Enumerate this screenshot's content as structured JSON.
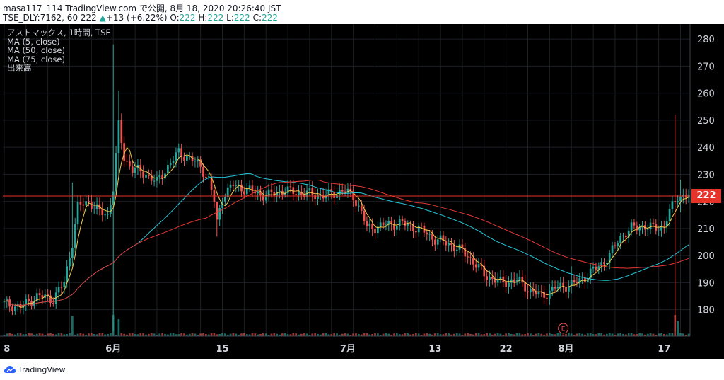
{
  "header": {
    "line1": "masa117_114 TradingView.com で公開, 8月 18, 2020 20:26:40 JST",
    "line2_symbol": "TSE_DLY:7162, 60 ",
    "line2_last": "222",
    "line2_arrow": "▲",
    "line2_change": "+13 (+6.22%)",
    "o_label": " O:",
    "o_value": "222",
    "h_label": " H:",
    "h_value": "222",
    "l_label": " L:",
    "l_value": "222",
    "c_label": " C:",
    "c_value": "222"
  },
  "legend": {
    "title": "アストマックス, 1時間, TSE",
    "ma5": "MA (5, close)",
    "ma50": "MA (50, close)",
    "ma75": "MA (75, close)",
    "volume": "出来高"
  },
  "footer": {
    "brand": "TradingView"
  },
  "price_tag": "222",
  "colors": {
    "up": "#26a69a",
    "down": "#ef5350",
    "ma5": "#f2c94c",
    "ma50": "#26c6da",
    "ma75": "#e53935",
    "price_line": "#e6342a",
    "axis_text": "#d1d4dc",
    "grid": "#1c1f26"
  },
  "chart_data": {
    "type": "candlestick",
    "interval": "1時間",
    "y_axis_ticks": [
      180,
      190,
      200,
      210,
      220,
      230,
      240,
      250,
      260,
      270,
      280
    ],
    "ylim": [
      171,
      285
    ],
    "x_tick_labels": [
      {
        "label": "8",
        "bar": 1
      },
      {
        "label": "6月",
        "bar": 40
      },
      {
        "label": "15",
        "bar": 80
      },
      {
        "label": "7月",
        "bar": 126
      },
      {
        "label": "13",
        "bar": 158
      },
      {
        "label": "22",
        "bar": 184
      },
      {
        "label": "8月",
        "bar": 206
      },
      {
        "label": "17",
        "bar": 242
      }
    ],
    "bar_count": 252,
    "close_anchors": [
      [
        0,
        182
      ],
      [
        6,
        181
      ],
      [
        12,
        185
      ],
      [
        18,
        184
      ],
      [
        22,
        190
      ],
      [
        25,
        205
      ],
      [
        27,
        218
      ],
      [
        31,
        220
      ],
      [
        35,
        216
      ],
      [
        38,
        215
      ],
      [
        40,
        225
      ],
      [
        42,
        248
      ],
      [
        44,
        236
      ],
      [
        47,
        232
      ],
      [
        52,
        230
      ],
      [
        56,
        227
      ],
      [
        60,
        233
      ],
      [
        64,
        238
      ],
      [
        68,
        236
      ],
      [
        72,
        233
      ],
      [
        75,
        228
      ],
      [
        77,
        220
      ],
      [
        78,
        212
      ],
      [
        80,
        222
      ],
      [
        84,
        226
      ],
      [
        90,
        224
      ],
      [
        96,
        222
      ],
      [
        102,
        224
      ],
      [
        110,
        223
      ],
      [
        118,
        222
      ],
      [
        124,
        224
      ],
      [
        128,
        222
      ],
      [
        131,
        216
      ],
      [
        133,
        210
      ],
      [
        138,
        211
      ],
      [
        145,
        212
      ],
      [
        152,
        210
      ],
      [
        158,
        206
      ],
      [
        164,
        204
      ],
      [
        170,
        200
      ],
      [
        176,
        193
      ],
      [
        182,
        190
      ],
      [
        188,
        191
      ],
      [
        193,
        187
      ],
      [
        197,
        185
      ],
      [
        202,
        188
      ],
      [
        206,
        189
      ],
      [
        210,
        190
      ],
      [
        214,
        193
      ],
      [
        218,
        196
      ],
      [
        222,
        200
      ],
      [
        226,
        207
      ],
      [
        230,
        210
      ],
      [
        234,
        211
      ],
      [
        238,
        210
      ],
      [
        242,
        211
      ],
      [
        244,
        216
      ],
      [
        247,
        222
      ],
      [
        251,
        222
      ]
    ],
    "spikes": [
      {
        "bar": 40,
        "high": 278,
        "low": 172
      },
      {
        "bar": 42,
        "high": 261,
        "low": 228
      },
      {
        "bar": 25,
        "high": 227,
        "low": 196
      },
      {
        "bar": 78,
        "high": 217,
        "low": 207
      },
      {
        "bar": 208,
        "high": 196,
        "low": 186
      },
      {
        "bar": 246,
        "high": 252,
        "low": 172
      },
      {
        "bar": 248,
        "high": 228,
        "low": 216
      }
    ],
    "volume_spikes": [
      {
        "bar": 25,
        "value": 0.95
      },
      {
        "bar": 40,
        "value": 1.0
      },
      {
        "bar": 42,
        "value": 0.8
      },
      {
        "bar": 246,
        "value": 1.0
      },
      {
        "bar": 247,
        "value": 0.7
      }
    ],
    "series": [
      {
        "name": "MA (5, close)",
        "period": 5
      },
      {
        "name": "MA (50, close)",
        "period": 50
      },
      {
        "name": "MA (75, close)",
        "period": 75
      }
    ],
    "last_price": 222,
    "events": [
      {
        "label": "E",
        "bar": 205
      }
    ]
  }
}
